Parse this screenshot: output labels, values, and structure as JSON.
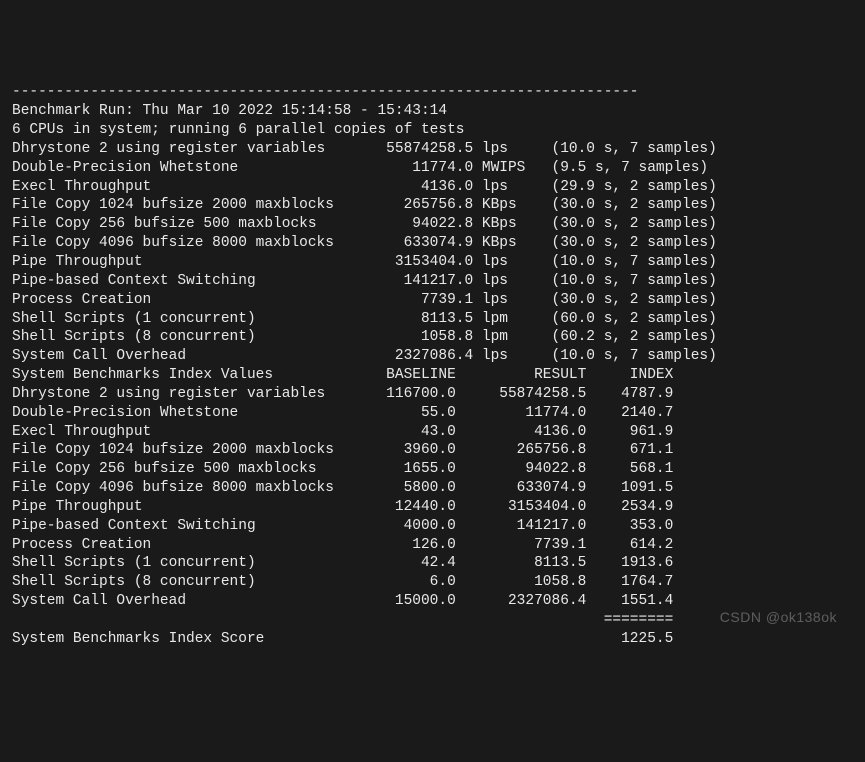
{
  "divider": "------------------------------------------------------------------------",
  "header": {
    "run_line": "Benchmark Run: Thu Mar 10 2022 15:14:58 - 15:43:14",
    "cpu_line": "6 CPUs in system; running 6 parallel copies of tests"
  },
  "results": [
    {
      "name": "Dhrystone 2 using register variables",
      "value": "55874258.5",
      "unit": "lps",
      "timing": "(10.0 s, 7 samples)"
    },
    {
      "name": "Double-Precision Whetstone",
      "value": "11774.0",
      "unit": "MWIPS",
      "timing": "(9.5 s, 7 samples)"
    },
    {
      "name": "Execl Throughput",
      "value": "4136.0",
      "unit": "lps",
      "timing": "(29.9 s, 2 samples)"
    },
    {
      "name": "File Copy 1024 bufsize 2000 maxblocks",
      "value": "265756.8",
      "unit": "KBps",
      "timing": "(30.0 s, 2 samples)"
    },
    {
      "name": "File Copy 256 bufsize 500 maxblocks",
      "value": "94022.8",
      "unit": "KBps",
      "timing": "(30.0 s, 2 samples)"
    },
    {
      "name": "File Copy 4096 bufsize 8000 maxblocks",
      "value": "633074.9",
      "unit": "KBps",
      "timing": "(30.0 s, 2 samples)"
    },
    {
      "name": "Pipe Throughput",
      "value": "3153404.0",
      "unit": "lps",
      "timing": "(10.0 s, 7 samples)"
    },
    {
      "name": "Pipe-based Context Switching",
      "value": "141217.0",
      "unit": "lps",
      "timing": "(10.0 s, 7 samples)"
    },
    {
      "name": "Process Creation",
      "value": "7739.1",
      "unit": "lps",
      "timing": "(30.0 s, 2 samples)"
    },
    {
      "name": "Shell Scripts (1 concurrent)",
      "value": "8113.5",
      "unit": "lpm",
      "timing": "(60.0 s, 2 samples)"
    },
    {
      "name": "Shell Scripts (8 concurrent)",
      "value": "1058.8",
      "unit": "lpm",
      "timing": "(60.2 s, 2 samples)"
    },
    {
      "name": "System Call Overhead",
      "value": "2327086.4",
      "unit": "lps",
      "timing": "(10.0 s, 7 samples)"
    }
  ],
  "index_header": {
    "title": "System Benchmarks Index Values",
    "col_baseline": "BASELINE",
    "col_result": "RESULT",
    "col_index": "INDEX"
  },
  "index_rows": [
    {
      "name": "Dhrystone 2 using register variables",
      "baseline": "116700.0",
      "result": "55874258.5",
      "index": "4787.9"
    },
    {
      "name": "Double-Precision Whetstone",
      "baseline": "55.0",
      "result": "11774.0",
      "index": "2140.7"
    },
    {
      "name": "Execl Throughput",
      "baseline": "43.0",
      "result": "4136.0",
      "index": "961.9"
    },
    {
      "name": "File Copy 1024 bufsize 2000 maxblocks",
      "baseline": "3960.0",
      "result": "265756.8",
      "index": "671.1"
    },
    {
      "name": "File Copy 256 bufsize 500 maxblocks",
      "baseline": "1655.0",
      "result": "94022.8",
      "index": "568.1"
    },
    {
      "name": "File Copy 4096 bufsize 8000 maxblocks",
      "baseline": "5800.0",
      "result": "633074.9",
      "index": "1091.5"
    },
    {
      "name": "Pipe Throughput",
      "baseline": "12440.0",
      "result": "3153404.0",
      "index": "2534.9"
    },
    {
      "name": "Pipe-based Context Switching",
      "baseline": "4000.0",
      "result": "141217.0",
      "index": "353.0"
    },
    {
      "name": "Process Creation",
      "baseline": "126.0",
      "result": "7739.1",
      "index": "614.2"
    },
    {
      "name": "Shell Scripts (1 concurrent)",
      "baseline": "42.4",
      "result": "8113.5",
      "index": "1913.6"
    },
    {
      "name": "Shell Scripts (8 concurrent)",
      "baseline": "6.0",
      "result": "1058.8",
      "index": "1764.7"
    },
    {
      "name": "System Call Overhead",
      "baseline": "15000.0",
      "result": "2327086.4",
      "index": "1551.4"
    }
  ],
  "score_divider": "========",
  "score_label_row": {
    "label": "System Benchmarks Index Score",
    "value": "1225.5"
  },
  "watermark": "CSDN @ok138ok"
}
